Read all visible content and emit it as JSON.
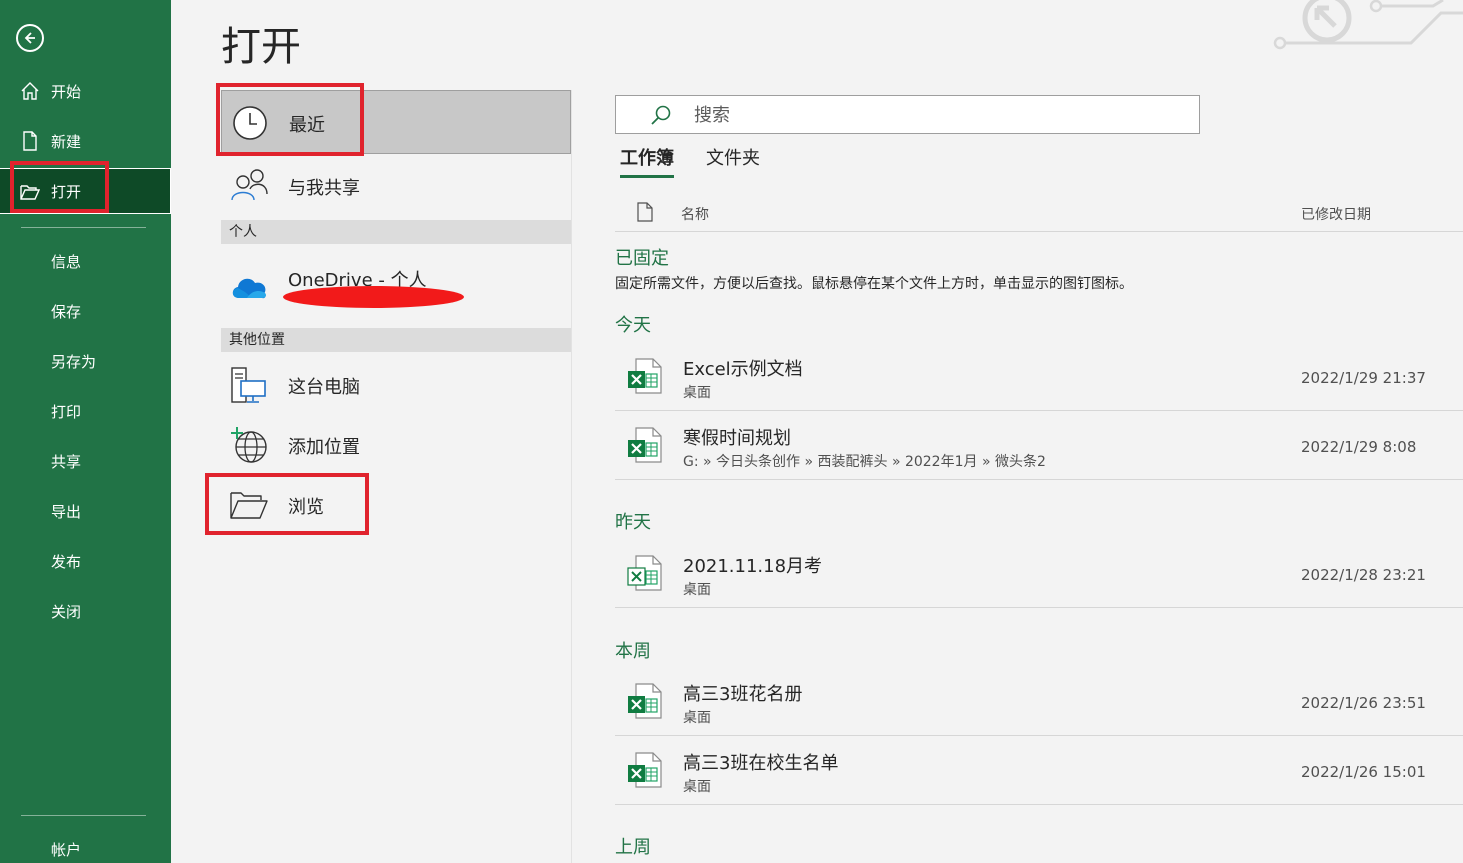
{
  "sidebar": {
    "items": [
      {
        "label": "开始",
        "icon": "home-icon"
      },
      {
        "label": "新建",
        "icon": "new-document-icon"
      },
      {
        "label": "打开",
        "icon": "folder-open-icon"
      },
      {
        "label": "信息"
      },
      {
        "label": "保存"
      },
      {
        "label": "另存为"
      },
      {
        "label": "打印"
      },
      {
        "label": "共享"
      },
      {
        "label": "导出"
      },
      {
        "label": "发布"
      },
      {
        "label": "关闭"
      }
    ],
    "account_label": "帐户",
    "accent_color": "#217346"
  },
  "page_title": "打开",
  "locations": {
    "recent": "最近",
    "shared": "与我共享",
    "group_personal": "个人",
    "onedrive": "OneDrive - 个人",
    "group_other": "其他位置",
    "this_pc": "这台电脑",
    "add_place": "添加位置",
    "browse": "浏览"
  },
  "search": {
    "placeholder": "搜索"
  },
  "tabs": [
    "工作簿",
    "文件夹"
  ],
  "list_header": {
    "name": "名称",
    "date": "已修改日期"
  },
  "sections": {
    "pinned": "已固定",
    "pinned_hint": "固定所需文件，方便以后查找。鼠标悬停在某个文件上方时，单击显示的图钉图标。",
    "today": "今天",
    "yesterday": "昨天",
    "this_week": "本周",
    "last_week": "上周"
  },
  "files": [
    {
      "name": "Excel示例文档",
      "path": "桌面",
      "date": "2022/1/29 21:37"
    },
    {
      "name": "寒假时间规划",
      "path": "G: » 今日头条创作 » 西装配裤头 » 2022年1月 » 微头条2",
      "date": "2022/1/29 8:08"
    },
    {
      "name": "2021.11.18月考",
      "path": "桌面",
      "date": "2022/1/28 23:21"
    },
    {
      "name": "高三3班花名册",
      "path": "桌面",
      "date": "2022/1/26 23:51"
    },
    {
      "name": "高三3班在校生名单",
      "path": "桌面",
      "date": "2022/1/26 15:01"
    }
  ]
}
